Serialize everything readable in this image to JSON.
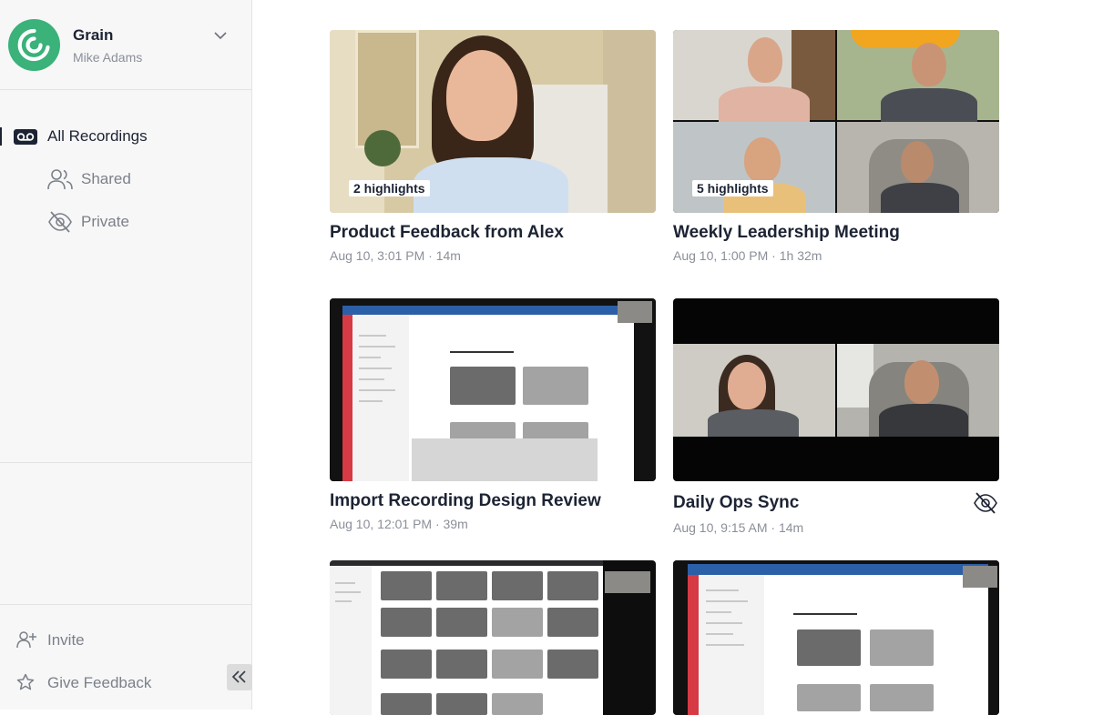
{
  "workspace": {
    "name": "Grain",
    "user": "Mike Adams"
  },
  "nav": {
    "all_recordings": "All Recordings",
    "shared": "Shared",
    "private": "Private"
  },
  "footer": {
    "invite": "Invite",
    "give_feedback": "Give Feedback"
  },
  "recordings": [
    {
      "title": "Product Feedback from Alex",
      "meta": "Aug 10, 3:01 PM · 14m",
      "highlights": "2 highlights"
    },
    {
      "title": "Weekly Leadership Meeting",
      "meta": "Aug 10, 1:00 PM · 1h 32m",
      "highlights": "5 highlights"
    },
    {
      "title": "Import Recording Design Review",
      "meta": "Aug 10, 12:01 PM · 39m"
    },
    {
      "title": "Daily Ops Sync",
      "meta": "Aug 10, 9:15 AM · 14m",
      "private": true
    },
    {
      "title": "",
      "meta": ""
    },
    {
      "title": "",
      "meta": ""
    }
  ],
  "colors": {
    "brand": "#3ab27a",
    "text": "#1c2333",
    "muted": "#8a8f99",
    "sidebar_bg": "#f7f7f7"
  }
}
